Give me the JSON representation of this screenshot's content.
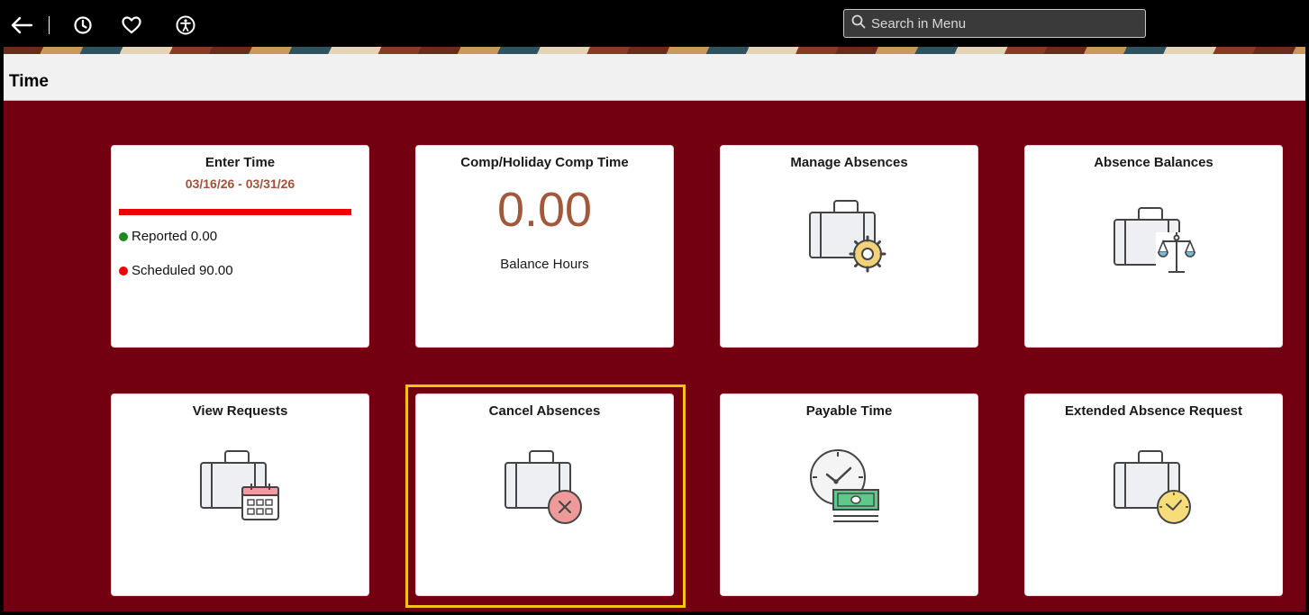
{
  "header": {
    "search_placeholder": "Search in Menu",
    "icons": [
      "back-arrow-icon",
      "recent-history-icon",
      "favorites-heart-icon",
      "accessibility-icon",
      "search-icon"
    ]
  },
  "page": {
    "title": "Time"
  },
  "colors": {
    "background": "#730010",
    "accent_number": "#a0593c",
    "period_text": "#a0523a",
    "progress_bar": "#ef0000",
    "reported_dot": "#1b8a1b",
    "scheduled_dot": "#ef0000",
    "selection_outline": "#f3c317"
  },
  "tiles": {
    "enter_time": {
      "title": "Enter Time",
      "period": "03/16/26 - 03/31/26",
      "reported": "Reported 0.00",
      "scheduled": "Scheduled 90.00"
    },
    "comp_time": {
      "title": "Comp/Holiday Comp Time",
      "value": "0.00",
      "label": "Balance Hours"
    },
    "manage_absences": {
      "title": "Manage Absences",
      "icon": "briefcase-gear-icon"
    },
    "absence_balances": {
      "title": "Absence Balances",
      "icon": "briefcase-scale-icon"
    },
    "view_requests": {
      "title": "View Requests",
      "icon": "briefcase-calendar-icon"
    },
    "cancel_absences": {
      "title": "Cancel Absences",
      "icon": "briefcase-cancel-icon",
      "selected": true
    },
    "payable_time": {
      "title": "Payable Time",
      "icon": "clock-money-icon"
    },
    "extended_absence": {
      "title": "Extended Absence Request",
      "icon": "briefcase-clock-icon"
    }
  }
}
